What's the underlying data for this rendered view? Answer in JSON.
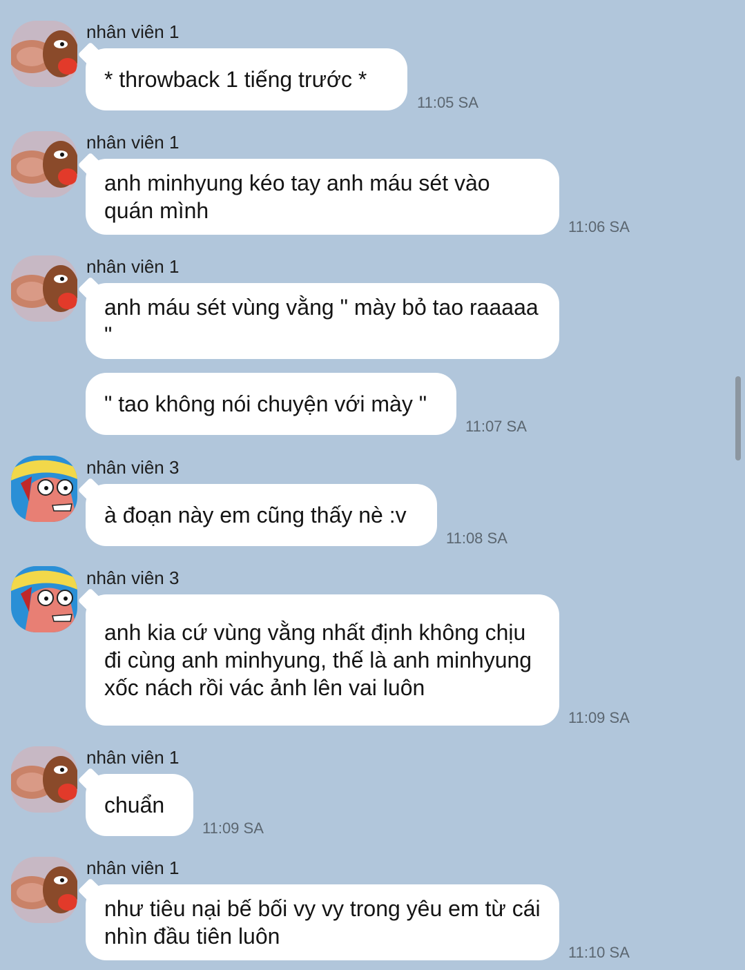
{
  "messages": [
    {
      "sender": "nhân viên 1",
      "avatar": "mouse-avatar-icon",
      "text": "* throwback 1 tiếng trước *",
      "time": "11:05 SA"
    },
    {
      "sender": "nhân viên 1",
      "avatar": "mouse-avatar-icon",
      "text": "anh minhyung kéo tay anh máu sét vào quán mình",
      "time": "11:06 SA"
    },
    {
      "sender": "nhân viên 1",
      "avatar": "mouse-avatar-icon",
      "text": "anh máu sét vùng vằng \" mày bỏ tao raaaaa \"",
      "time": ""
    },
    {
      "sender": "",
      "avatar": "",
      "text": "\" tao không nói chuyện với mày \"",
      "time": "11:07 SA"
    },
    {
      "sender": "nhân viên 3",
      "avatar": "starfish-avatar-icon",
      "text": "à đoạn này em cũng thấy nè :v",
      "time": "11:08 SA"
    },
    {
      "sender": "nhân viên 3",
      "avatar": "starfish-avatar-icon",
      "text": "anh kia cứ vùng vằng nhất định không chịu đi cùng anh minhyung, thế là anh minhyung xốc nách rồi vác ảnh lên vai luôn",
      "time": "11:09 SA"
    },
    {
      "sender": "nhân viên 1",
      "avatar": "mouse-avatar-icon",
      "text": "chuẩn",
      "time": "11:09 SA"
    },
    {
      "sender": "nhân viên 1",
      "avatar": "mouse-avatar-icon",
      "text": "như tiêu nại bế bối vy vy trong yêu em từ cái nhìn đầu tiên luôn",
      "time": "11:10 SA"
    }
  ]
}
